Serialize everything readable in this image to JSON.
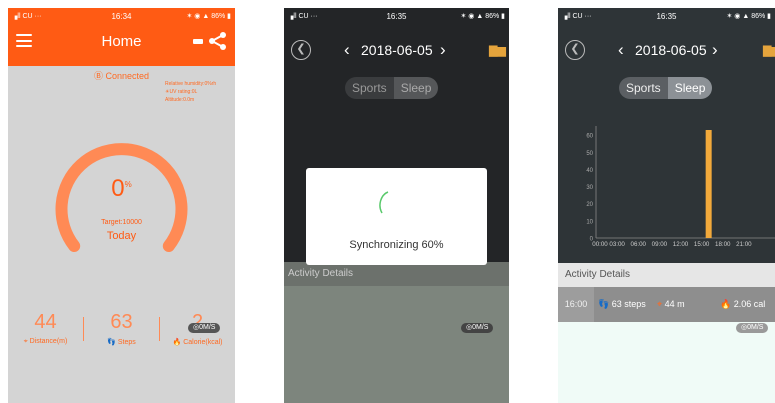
{
  "screen1": {
    "status": {
      "carrier": "▗ll CU ···",
      "time": "16:34",
      "right": "✶ ◉ ▲ 86% ▮"
    },
    "title": "Home",
    "connection": "Connected",
    "environment": [
      "Relative humidity:0%rh",
      "UV rating:0L",
      "Altitude:0.0m"
    ],
    "progress": {
      "percent": "0",
      "unit": "%",
      "fraction": 0.0
    },
    "target": "Target:10000",
    "period": "Today",
    "stats": [
      {
        "value": "44",
        "label": "Distance(m)"
      },
      {
        "value": "63",
        "label": "Steps"
      },
      {
        "value": "2",
        "label": "Calorie(kcal)"
      }
    ],
    "speed": "◎0M/S",
    "colors": {
      "accent": "#ff5b14",
      "background": "#d4d4d4"
    }
  },
  "screen2": {
    "status": {
      "carrier": "▗ll CU ···",
      "time": "16:35",
      "right": "✶ ◉ ▲ 86% ▮"
    },
    "date": "2018-06-05",
    "tabs": [
      "Sports",
      "Sleep"
    ],
    "sync_text": "Synchronizing 60%",
    "details_title": "Activity Details",
    "speed": "◎0M/S"
  },
  "screen3": {
    "status": {
      "carrier": "▗ll CU ···",
      "time": "16:35",
      "right": "✶ ◉ ▲ 86% ▮"
    },
    "date": "2018-06-05",
    "tabs": [
      "Sports",
      "Sleep"
    ],
    "details_title": "Activity Details",
    "row": {
      "time": "16:00",
      "steps": "63 steps",
      "distance": "44 m",
      "calories": "2.06 cal"
    },
    "speed": "◎0M/S"
  },
  "chart_data": {
    "type": "bar",
    "x_ticks": [
      "00:00",
      "03:00",
      "06:00",
      "09:00",
      "12:00",
      "15:00",
      "18:00",
      "21:00"
    ],
    "y_ticks": [
      "0",
      "10",
      "20",
      "30",
      "40",
      "50",
      "60"
    ],
    "ylim": [
      0,
      63
    ],
    "bars": [
      {
        "x_hour": 16,
        "value": 63
      }
    ],
    "bar_color": "#f2a93b"
  }
}
